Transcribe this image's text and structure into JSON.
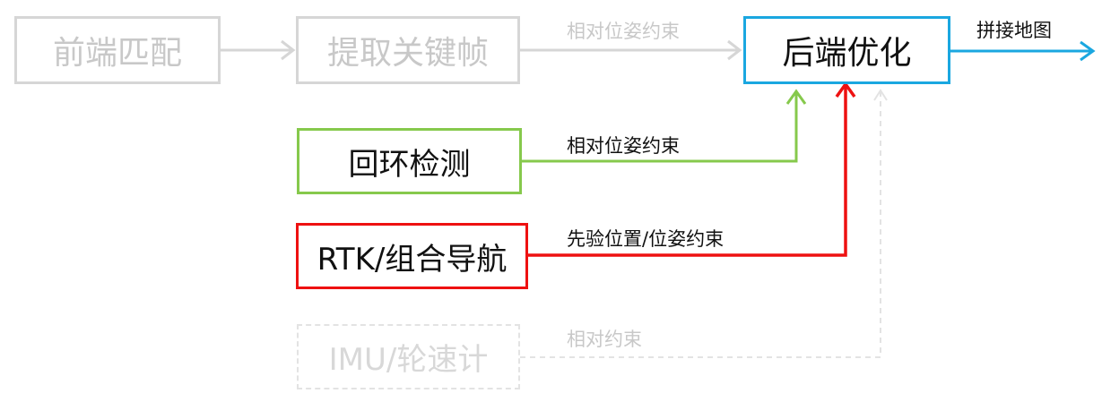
{
  "nodes": {
    "frontend_matching": "前端匹配",
    "keyframe_extraction": "提取关键帧",
    "backend_optimization": "后端优化",
    "loop_closure": "回环检测",
    "rtk_ins": "RTK/组合导航",
    "imu_odometer": "IMU/轮速计"
  },
  "edges": {
    "keyframe_to_backend": "相对位姿约束",
    "loop_to_backend": "相对位姿约束",
    "rtk_to_backend": "先验位置/位姿约束",
    "imu_to_backend": "相对约束",
    "backend_output": "拼接地图"
  },
  "colors": {
    "faded": "#d6d6d6",
    "faded_text": "#c8c8c8",
    "backend": "#1aa7e0",
    "loop": "#86c94c",
    "rtk": "#ee1111",
    "imu_dashed": "#e3e3e3",
    "text": "#111111"
  }
}
